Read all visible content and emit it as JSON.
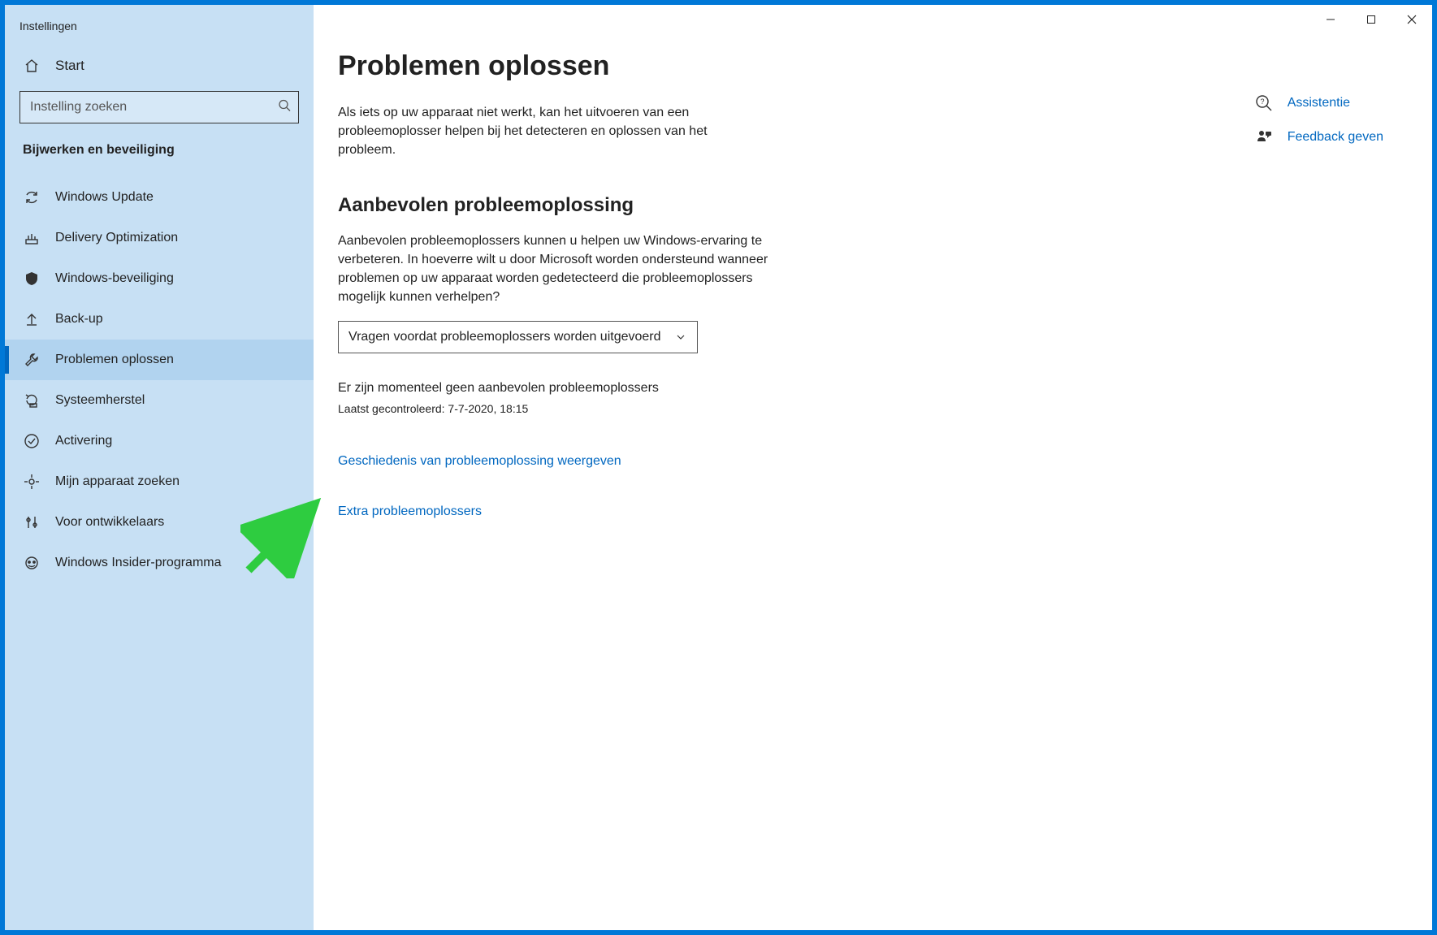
{
  "window": {
    "title": "Instellingen"
  },
  "sidebar": {
    "home_label": "Start",
    "search_placeholder": "Instelling zoeken",
    "category_title": "Bijwerken en beveiliging",
    "items": [
      {
        "label": "Windows Update"
      },
      {
        "label": "Delivery Optimization"
      },
      {
        "label": "Windows-beveiliging"
      },
      {
        "label": "Back-up"
      },
      {
        "label": "Problemen oplossen"
      },
      {
        "label": "Systeemherstel"
      },
      {
        "label": "Activering"
      },
      {
        "label": "Mijn apparaat zoeken"
      },
      {
        "label": "Voor ontwikkelaars"
      },
      {
        "label": "Windows Insider-programma"
      }
    ]
  },
  "main": {
    "page_title": "Problemen oplossen",
    "page_desc": "Als iets op uw apparaat niet werkt, kan het uitvoeren van een probleemoplosser helpen bij het detecteren en oplossen van het probleem.",
    "section_title": "Aanbevolen probleemoplossing",
    "section_desc": "Aanbevolen probleemoplossers kunnen u helpen uw Windows-ervaring te verbeteren. In hoeverre wilt u door Microsoft worden ondersteund wanneer problemen op uw apparaat worden gedetecteerd die probleemoplossers mogelijk kunnen verhelpen?",
    "dropdown_value": "Vragen voordat probleemoplossers worden uitgevoerd",
    "status_line": "Er zijn momenteel geen aanbevolen probleemoplossers",
    "last_checked": "Laatst gecontroleerd: 7-7-2020, 18:15",
    "history_link": "Geschiedenis van probleemoplossing weergeven",
    "extra_link": "Extra probleemoplossers"
  },
  "aside": {
    "help_label": "Assistentie",
    "feedback_label": "Feedback geven"
  }
}
